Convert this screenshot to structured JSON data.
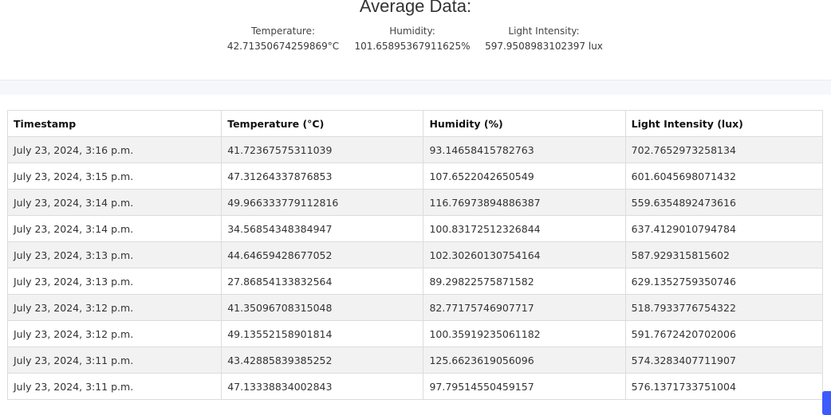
{
  "summary": {
    "title": "Average Data:",
    "temperature": {
      "label": "Temperature:",
      "value": "42.71350674259869°C"
    },
    "humidity": {
      "label": "Humidity:",
      "value": "101.65895367911625%"
    },
    "light": {
      "label": "Light Intensity:",
      "value": "597.9508983102397 lux"
    }
  },
  "table": {
    "headers": [
      "Timestamp",
      "Temperature (°C)",
      "Humidity (%)",
      "Light Intensity (lux)"
    ],
    "rows": [
      [
        "July 23, 2024, 3:16 p.m.",
        "41.72367575311039",
        "93.14658415782763",
        "702.7652973258134"
      ],
      [
        "July 23, 2024, 3:15 p.m.",
        "47.31264337876853",
        "107.6522042650549",
        "601.6045698071432"
      ],
      [
        "July 23, 2024, 3:14 p.m.",
        "49.966333779112816",
        "116.76973894886387",
        "559.6354892473616"
      ],
      [
        "July 23, 2024, 3:14 p.m.",
        "34.56854348384947",
        "100.83172512326844",
        "637.4129010794784"
      ],
      [
        "July 23, 2024, 3:13 p.m.",
        "44.64659428677052",
        "102.30260130754164",
        "587.929315815602"
      ],
      [
        "July 23, 2024, 3:13 p.m.",
        "27.86854133832564",
        "89.29822575871582",
        "629.1352759350746"
      ],
      [
        "July 23, 2024, 3:12 p.m.",
        "41.35096708315048",
        "82.77175746907717",
        "518.7933776754322"
      ],
      [
        "July 23, 2024, 3:12 p.m.",
        "49.13552158901814",
        "100.35919235061182",
        "591.7672420702006"
      ],
      [
        "July 23, 2024, 3:11 p.m.",
        "43.42885839385252",
        "125.6623619056096",
        "574.3283407711907"
      ],
      [
        "July 23, 2024, 3:11 p.m.",
        "47.13338834002843",
        "97.79514550459157",
        "576.1371733751004"
      ]
    ]
  },
  "colors": {
    "accent": "#3d5afe",
    "row_stripe": "#f2f2f2",
    "border": "#dcdcdc"
  }
}
